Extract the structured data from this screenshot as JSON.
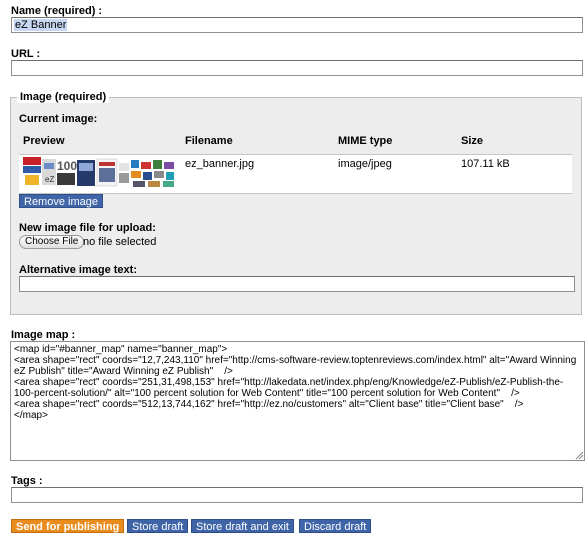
{
  "name": {
    "label": "Name (required) :",
    "value": "eZ Banner"
  },
  "url": {
    "label": "URL :",
    "value": ""
  },
  "image": {
    "legend": "Image (required)",
    "current_label": "Current image:",
    "columns": {
      "preview": "Preview",
      "filename": "Filename",
      "mime": "MIME type",
      "size": "Size"
    },
    "row": {
      "filename": "ez_banner.jpg",
      "mime": "image/jpeg",
      "size": "107.11 kB"
    },
    "remove_label": "Remove image",
    "new_file_label": "New image file for upload:",
    "choose_label": "Choose File",
    "no_file": "no file selected",
    "alt_label": "Alternative image text:",
    "alt_value": ""
  },
  "image_map": {
    "label": "Image map :",
    "value": "<map id=\"#banner_map\" name=\"banner_map\">\n<area shape=\"rect\" coords=\"12,7,243,110\" href=\"http://cms-software-review.toptenreviews.com/index.html\" alt=\"Award Winning eZ Publish\" title=\"Award Winning eZ Publish\"    />\n<area shape=\"rect\" coords=\"251,31,498,153\" href=\"http://lakedata.net/index.php/eng/Knowledge/eZ-Publish/eZ-Publish-the-100-percent-solution/\" alt=\"100 percent solution for Web Content\" title=\"100 percent solution for Web Content\"    />\n<area shape=\"rect\" coords=\"512,13,744,162\" href=\"http://ez.no/customers\" alt=\"Client base\" title=\"Client base\"    />\n</map>"
  },
  "tags": {
    "label": "Tags :",
    "value": ""
  },
  "actions": {
    "send": "Send for publishing",
    "store": "Store draft",
    "store_exit": "Store draft and exit",
    "discard": "Discard draft"
  },
  "colors": {
    "primary_button": "#3f65a8",
    "publish_button": "#e98b1d",
    "panel_bg": "#ededed"
  }
}
